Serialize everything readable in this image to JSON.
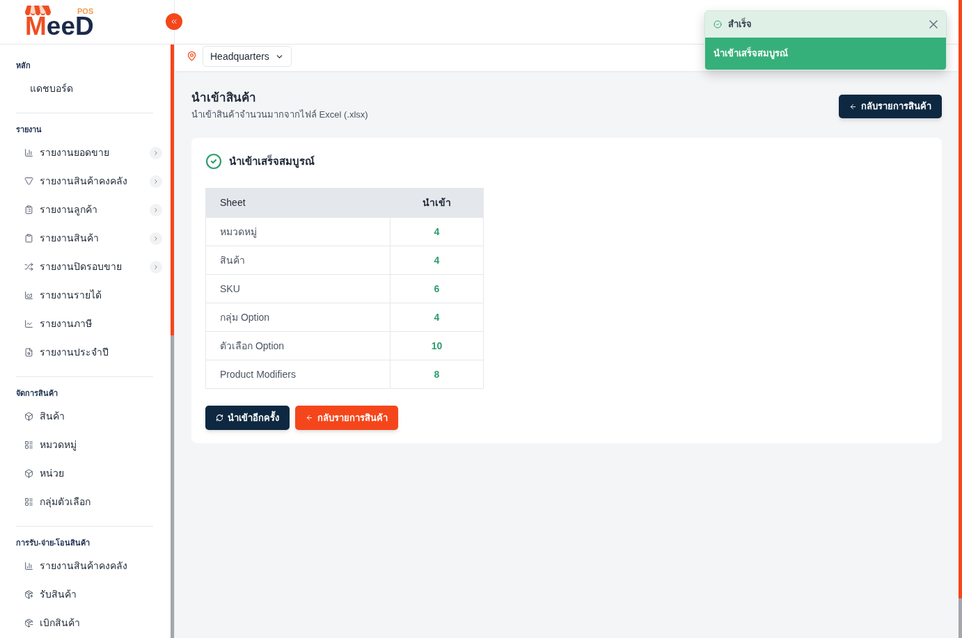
{
  "sidebar": {
    "logo": {
      "tag": "POS",
      "brand_first": "M",
      "brand_rest": "eeD"
    },
    "sections": [
      {
        "title": "หลัก",
        "items": [
          {
            "label": "แดชบอร์ด",
            "has_submenu": false
          }
        ]
      },
      {
        "title": "รายงาน",
        "items": [
          {
            "label": "รายงานยอดขาย",
            "has_submenu": true
          },
          {
            "label": "รายงานสินค้าคงคลัง",
            "has_submenu": true
          },
          {
            "label": "รายงานลูกค้า",
            "has_submenu": true
          },
          {
            "label": "รายงานสินค้า",
            "has_submenu": true
          },
          {
            "label": "รายงานปิดรอบขาย",
            "has_submenu": true
          },
          {
            "label": "รายงานรายได้",
            "has_submenu": false
          },
          {
            "label": "รายงานภาษี",
            "has_submenu": false
          },
          {
            "label": "รายงานประจำปี",
            "has_submenu": false
          }
        ]
      },
      {
        "title": "จัดการสินค้า",
        "items": [
          {
            "label": "สินค้า",
            "has_submenu": false
          },
          {
            "label": "หมวดหมู่",
            "has_submenu": false
          },
          {
            "label": "หน่วย",
            "has_submenu": false
          },
          {
            "label": "กลุ่มตัวเลือก",
            "has_submenu": false
          }
        ]
      },
      {
        "title": "การรับ-จ่าย-โอนสินค้า",
        "items": [
          {
            "label": "รายงานสินค้าคงคลัง",
            "has_submenu": false
          },
          {
            "label": "รับสินค้า",
            "has_submenu": false
          },
          {
            "label": "เบิกสินค้า",
            "has_submenu": false
          }
        ]
      }
    ]
  },
  "location_bar": {
    "branch": "Headquarters"
  },
  "page": {
    "title": "นำเข้าสินค้า",
    "subtitle": "นำเข้าสินค้าจำนวนมากจากไฟล์ Excel (.xlsx)",
    "back_button": "กลับรายการสินค้า"
  },
  "result_card": {
    "title": "นำเข้าเสร็จสมบูรณ์",
    "table": {
      "columns": [
        "Sheet",
        "นำเข้า"
      ],
      "rows": [
        {
          "sheet": "หมวดหมู่",
          "imported": "4"
        },
        {
          "sheet": "สินค้า",
          "imported": "4"
        },
        {
          "sheet": "SKU",
          "imported": "6"
        },
        {
          "sheet": "กลุ่ม Option",
          "imported": "4"
        },
        {
          "sheet": "ตัวเลือก Option",
          "imported": "10"
        },
        {
          "sheet": "Product Modifiers",
          "imported": "8"
        }
      ]
    },
    "buttons": [
      {
        "kind": "primary",
        "label": "นำเข้าอีกครั้ง"
      },
      {
        "kind": "accent",
        "label": "กลับรายการสินค้า"
      }
    ]
  },
  "toast": {
    "title": "สำเร็จ",
    "message": "นำเข้าเสร็จสมบูรณ์"
  }
}
